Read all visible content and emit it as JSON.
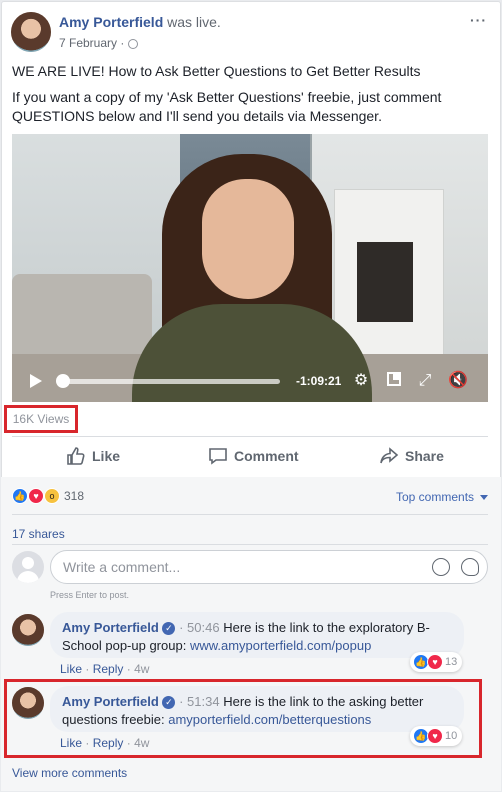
{
  "post": {
    "author": "Amy Porterfield",
    "action": "was live.",
    "date": "7 February",
    "date_separator": "·",
    "more_label": "···",
    "headline": "WE ARE LIVE! How to Ask Better Questions to Get Better Results",
    "body": "If you want a copy of my 'Ask Better Questions' freebie, just comment QUESTIONS below and I'll send you details via Messenger."
  },
  "video": {
    "time_remaining": "-1:09:21",
    "views": "16K Views"
  },
  "actions": {
    "like": "Like",
    "comment": "Comment",
    "share": "Share"
  },
  "reactions": {
    "count": "318",
    "sort_label": "Top comments",
    "shares": "17 shares"
  },
  "composer": {
    "placeholder": "Write a comment...",
    "hint": "Press Enter to post."
  },
  "comments": [
    {
      "author": "Amy Porterfield",
      "timestamp": "50:46",
      "text": "Here is the link to the exploratory B-School pop-up group: ",
      "link": "www.amyporterfield.com/popup",
      "like": "Like",
      "reply": "Reply",
      "age": "4w",
      "reaction_count": "13"
    },
    {
      "author": "Amy Porterfield",
      "timestamp": "51:34",
      "text": "Here is the link to the asking better questions freebie: ",
      "link": "amyporterfield.com/betterquestions",
      "like": "Like",
      "reply": "Reply",
      "age": "4w",
      "reaction_count": "10"
    }
  ],
  "view_more": "View more comments",
  "colors": {
    "link_blue": "#385898",
    "highlight_red": "#d8262c",
    "like_blue": "#2078f4",
    "love_red": "#f0284a"
  }
}
